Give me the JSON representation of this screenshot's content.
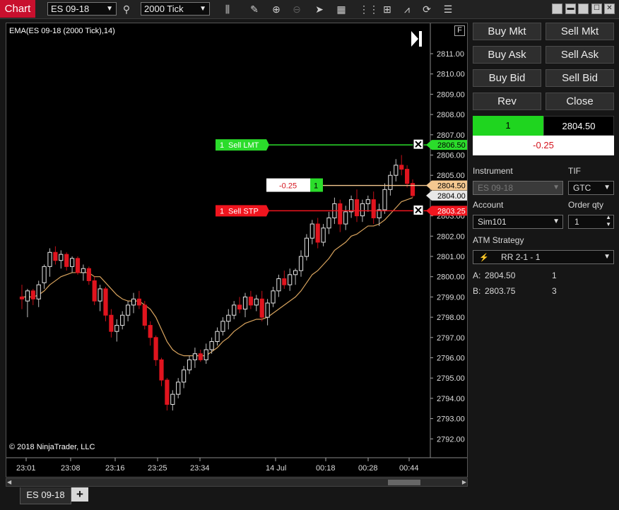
{
  "toolbar": {
    "title": "Chart",
    "instrument": "ES 09-18",
    "interval": "2000 Tick",
    "icons": [
      "search-icon",
      "bar-type-icon",
      "pencil-icon",
      "zoom-in-icon",
      "zoom-out-icon",
      "pointer-icon",
      "data-box-icon",
      "indicators-icon",
      "strategies-icon",
      "drawing-tools-icon",
      "refresh-icon",
      "properties-icon"
    ]
  },
  "chart": {
    "indicator_label": "EMA(ES 09-18 (2000 Tick),14)",
    "copyright": "© 2018 NinjaTrader, LLC",
    "f_label": "F",
    "orders": {
      "sell_lmt": {
        "qty": "1",
        "label": "Sell LMT",
        "price": "2806.50"
      },
      "sell_stp": {
        "qty": "1",
        "label": "Sell STP",
        "price": "2803.25"
      },
      "position": {
        "pnl": "-0.25",
        "qty": "1",
        "price": "2804.50"
      },
      "last_price": "2804.00"
    }
  },
  "chart_data": {
    "type": "candlestick",
    "ylim": [
      2792.0,
      2811.7
    ],
    "y_ticks": [
      "2811.00",
      "2810.00",
      "2809.00",
      "2808.00",
      "2807.00",
      "2806.00",
      "2805.00",
      "2804.00",
      "2803.00",
      "2802.00",
      "2801.00",
      "2800.00",
      "2799.00",
      "2798.00",
      "2797.00",
      "2796.00",
      "2795.00",
      "2794.00",
      "2793.00",
      "2792.00"
    ],
    "x_ticks": [
      "23:01",
      "23:08",
      "23:16",
      "23:25",
      "23:34",
      "14 Jul",
      "00:18",
      "00:28",
      "00:44"
    ],
    "candles": [
      [
        2799.0,
        2799.6,
        2798.4,
        2798.9
      ],
      [
        2798.8,
        2799.4,
        2798.0,
        2799.3
      ],
      [
        2799.3,
        2799.4,
        2798.6,
        2798.9
      ],
      [
        2798.9,
        2799.8,
        2798.5,
        2799.6
      ],
      [
        2799.7,
        2800.6,
        2799.4,
        2800.5
      ],
      [
        2800.5,
        2801.4,
        2800.0,
        2801.2
      ],
      [
        2801.2,
        2801.5,
        2800.6,
        2800.8
      ],
      [
        2800.8,
        2801.3,
        2800.4,
        2801.1
      ],
      [
        2801.1,
        2801.2,
        2800.3,
        2800.5
      ],
      [
        2800.5,
        2801.0,
        2800.2,
        2800.9
      ],
      [
        2800.9,
        2801.0,
        2800.1,
        2800.2
      ],
      [
        2800.2,
        2800.6,
        2799.8,
        2800.4
      ],
      [
        2800.4,
        2800.5,
        2799.6,
        2799.8
      ],
      [
        2799.8,
        2800.0,
        2798.6,
        2798.8
      ],
      [
        2798.8,
        2799.6,
        2798.3,
        2799.4
      ],
      [
        2799.4,
        2799.5,
        2797.8,
        2798.1
      ],
      [
        2798.1,
        2798.4,
        2797.0,
        2797.3
      ],
      [
        2797.3,
        2797.9,
        2796.8,
        2797.6
      ],
      [
        2797.6,
        2798.3,
        2797.4,
        2798.1
      ],
      [
        2798.1,
        2798.8,
        2797.8,
        2798.6
      ],
      [
        2798.6,
        2799.2,
        2798.2,
        2798.9
      ],
      [
        2798.9,
        2799.3,
        2798.4,
        2798.6
      ],
      [
        2798.6,
        2798.8,
        2797.4,
        2797.6
      ],
      [
        2797.6,
        2797.8,
        2796.6,
        2797.0
      ],
      [
        2797.0,
        2797.1,
        2795.6,
        2795.9
      ],
      [
        2795.9,
        2796.0,
        2794.6,
        2794.9
      ],
      [
        2794.9,
        2795.0,
        2793.4,
        2793.7
      ],
      [
        2793.7,
        2794.4,
        2793.4,
        2794.2
      ],
      [
        2794.2,
        2795.0,
        2794.0,
        2794.8
      ],
      [
        2794.8,
        2795.6,
        2794.5,
        2795.4
      ],
      [
        2795.4,
        2796.1,
        2795.2,
        2795.9
      ],
      [
        2795.9,
        2796.5,
        2795.5,
        2796.2
      ],
      [
        2796.2,
        2796.4,
        2795.8,
        2795.9
      ],
      [
        2795.9,
        2796.7,
        2795.7,
        2796.4
      ],
      [
        2796.4,
        2797.0,
        2796.2,
        2796.8
      ],
      [
        2796.8,
        2797.5,
        2796.6,
        2797.3
      ],
      [
        2797.3,
        2798.0,
        2797.1,
        2797.8
      ],
      [
        2797.8,
        2798.4,
        2797.4,
        2798.1
      ],
      [
        2798.1,
        2798.8,
        2797.9,
        2798.6
      ],
      [
        2798.6,
        2799.0,
        2798.2,
        2798.4
      ],
      [
        2798.4,
        2799.2,
        2798.0,
        2799.0
      ],
      [
        2799.0,
        2799.3,
        2798.4,
        2798.6
      ],
      [
        2798.6,
        2799.1,
        2798.3,
        2798.9
      ],
      [
        2798.9,
        2799.3,
        2797.8,
        2798.0
      ],
      [
        2798.0,
        2798.9,
        2797.6,
        2798.7
      ],
      [
        2798.7,
        2799.5,
        2798.5,
        2799.3
      ],
      [
        2799.3,
        2800.1,
        2799.0,
        2799.9
      ],
      [
        2799.9,
        2800.3,
        2799.4,
        2799.6
      ],
      [
        2799.6,
        2800.4,
        2799.3,
        2800.1
      ],
      [
        2800.1,
        2800.4,
        2799.6,
        2800.3
      ],
      [
        2800.3,
        2801.3,
        2800.0,
        2801.0
      ],
      [
        2801.0,
        2802.1,
        2800.8,
        2801.9
      ],
      [
        2801.9,
        2802.8,
        2801.6,
        2802.6
      ],
      [
        2802.6,
        2802.9,
        2801.4,
        2801.7
      ],
      [
        2801.7,
        2802.6,
        2801.5,
        2802.4
      ],
      [
        2802.4,
        2803.2,
        2802.1,
        2802.9
      ],
      [
        2802.9,
        2803.9,
        2802.6,
        2803.6
      ],
      [
        2803.6,
        2803.8,
        2802.2,
        2802.6
      ],
      [
        2802.6,
        2803.5,
        2802.3,
        2803.2
      ],
      [
        2803.2,
        2804.0,
        2802.9,
        2803.8
      ],
      [
        2803.8,
        2804.3,
        2802.7,
        2803.0
      ],
      [
        2803.0,
        2803.8,
        2802.7,
        2803.6
      ],
      [
        2803.6,
        2804.0,
        2803.2,
        2803.8
      ],
      [
        2803.8,
        2804.2,
        2802.6,
        2802.9
      ],
      [
        2802.9,
        2803.6,
        2802.5,
        2803.3
      ],
      [
        2803.3,
        2804.6,
        2803.1,
        2804.3
      ],
      [
        2804.3,
        2805.2,
        2804.0,
        2805.0
      ],
      [
        2805.0,
        2805.8,
        2804.7,
        2805.5
      ],
      [
        2805.5,
        2806.0,
        2805.0,
        2805.3
      ],
      [
        2805.3,
        2805.5,
        2804.4,
        2804.6
      ],
      [
        2804.6,
        2804.8,
        2803.9,
        2804.0
      ]
    ],
    "ema": [
      2799.0,
      2799.0,
      2799.0,
      2799.1,
      2799.3,
      2799.6,
      2799.8,
      2800.0,
      2800.1,
      2800.2,
      2800.2,
      2800.2,
      2800.2,
      2800.0,
      2800.0,
      2799.7,
      2799.4,
      2799.1,
      2798.9,
      2798.8,
      2798.8,
      2798.8,
      2798.6,
      2798.4,
      2798.0,
      2797.4,
      2796.8,
      2796.4,
      2796.2,
      2796.1,
      2796.1,
      2796.1,
      2796.1,
      2796.1,
      2796.3,
      2796.5,
      2796.8,
      2797.0,
      2797.3,
      2797.5,
      2797.7,
      2797.8,
      2797.9,
      2797.9,
      2798.0,
      2798.2,
      2798.4,
      2798.6,
      2798.8,
      2799.0,
      2799.3,
      2799.7,
      2800.1,
      2800.3,
      2800.6,
      2800.9,
      2801.3,
      2801.5,
      2801.7,
      2802.0,
      2802.1,
      2802.3,
      2802.5,
      2802.5,
      2802.6,
      2802.8,
      2803.1,
      2803.4,
      2803.7,
      2803.8,
      2803.9
    ]
  },
  "order_entry": {
    "buy_mkt": "Buy Mkt",
    "sell_mkt": "Sell Mkt",
    "buy_ask": "Buy Ask",
    "sell_ask": "Sell Ask",
    "buy_bid": "Buy Bid",
    "sell_bid": "Sell Bid",
    "rev": "Rev",
    "close": "Close",
    "position_qty": "1",
    "position_price": "2804.50",
    "unrealized": "-0.25",
    "instrument_label": "Instrument",
    "instrument_value": "ES 09-18",
    "tif_label": "TIF",
    "tif_value": "GTC",
    "account_label": "Account",
    "account_value": "Sim101",
    "qty_label": "Order qty",
    "qty_value": "1",
    "atm_label": "ATM Strategy",
    "atm_value": "RR 2-1 - 1",
    "brackets": [
      {
        "label": "A:",
        "price": "2804.50",
        "qty": "1"
      },
      {
        "label": "B:",
        "price": "2803.75",
        "qty": "3"
      }
    ]
  },
  "tabs": {
    "active": "ES 09-18",
    "add": "+"
  },
  "colors": {
    "up": "#e8e8e8",
    "down": "#e0141e",
    "ema": "#d9a45e",
    "lmt": "#2bdc2b",
    "stp": "#f0151e",
    "pos": "#f4c890",
    "title_red": "#c8102e"
  }
}
